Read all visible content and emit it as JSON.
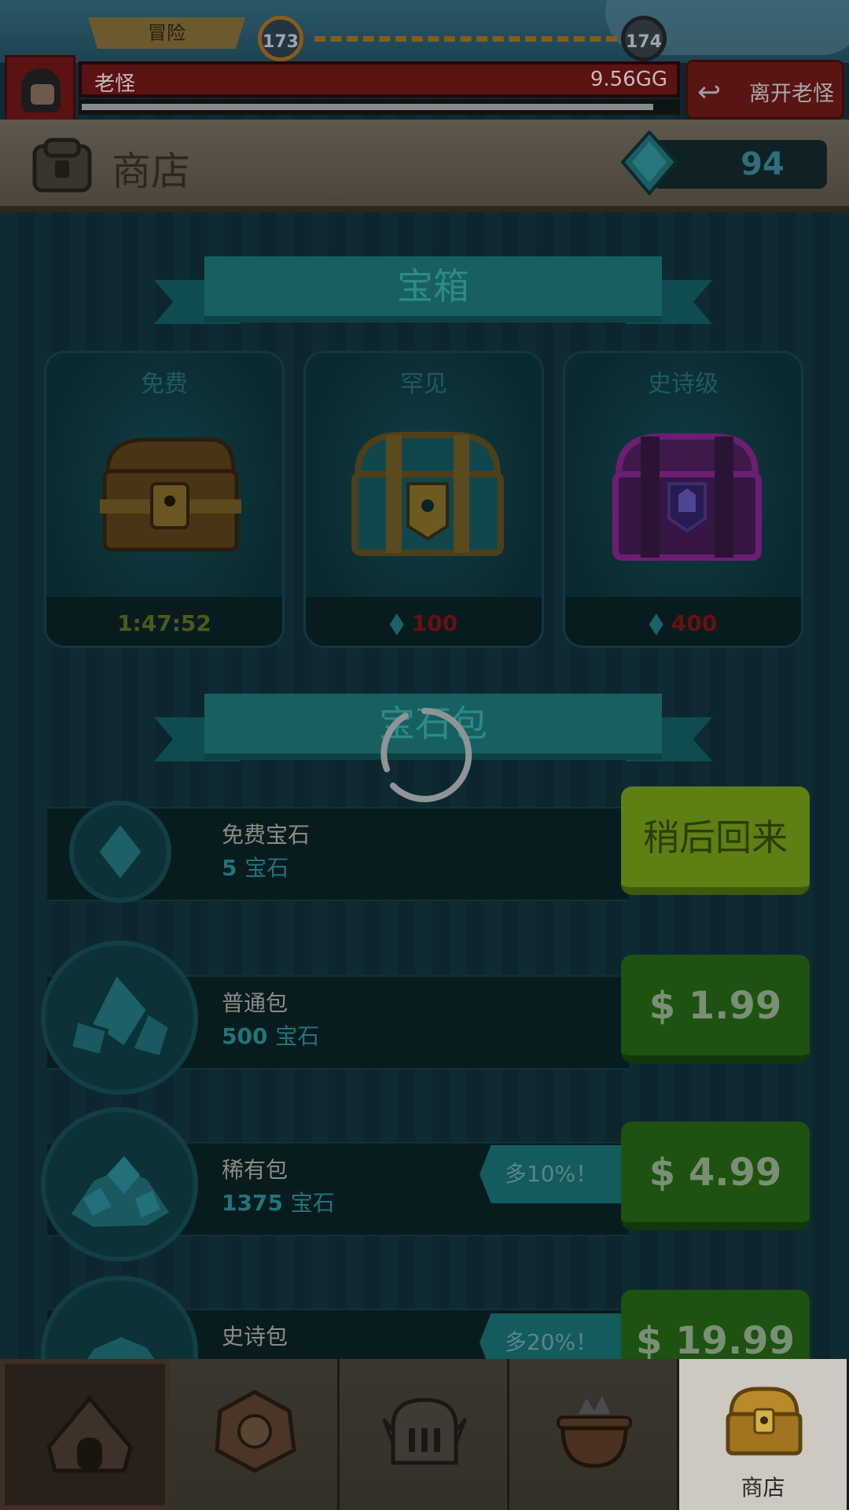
{
  "stage": {
    "mode_label": "冒险",
    "current_level": "173",
    "next_level": "174"
  },
  "boss": {
    "name": "老怪",
    "hp_value": "9.56GG",
    "hp_fraction": 1.0,
    "timer_fraction": 0.96,
    "leave_label": "离开老怪"
  },
  "header": {
    "title": "商店",
    "gem_count": "94"
  },
  "chests": {
    "section_title": "宝箱",
    "items": [
      {
        "name": "免费",
        "value": "1:47:52"
      },
      {
        "name": "罕见",
        "value": "100"
      },
      {
        "name": "史诗级",
        "value": "400"
      }
    ]
  },
  "gem_packs": {
    "section_title": "宝石包",
    "items": [
      {
        "name": "免费宝石",
        "qty": "5",
        "unit": "宝石",
        "button": "稍后回来",
        "bonus": ""
      },
      {
        "name": "普通包",
        "qty": "500",
        "unit": "宝石",
        "button": "$ 1.99",
        "bonus": ""
      },
      {
        "name": "稀有包",
        "qty": "1375",
        "unit": "宝石",
        "button": "$ 4.99",
        "bonus": "多10%！"
      },
      {
        "name": "史诗包",
        "qty": "",
        "unit": "",
        "button": "$ 19.99",
        "bonus": "多20%！"
      }
    ]
  },
  "nav": {
    "tabs": [
      {
        "icon": "tent-icon",
        "label": ""
      },
      {
        "icon": "artifact-icon",
        "label": ""
      },
      {
        "icon": "helmet-icon",
        "label": ""
      },
      {
        "icon": "cauldron-icon",
        "label": ""
      },
      {
        "icon": "chest-icon",
        "label": "商店"
      }
    ],
    "active_index": 4
  },
  "colors": {
    "dim_overlay": "#0b2128",
    "green_button": "#1d5210",
    "later_button": "#5c8014",
    "ribbon": "#17605f",
    "price_red": "#6b0f0f"
  }
}
